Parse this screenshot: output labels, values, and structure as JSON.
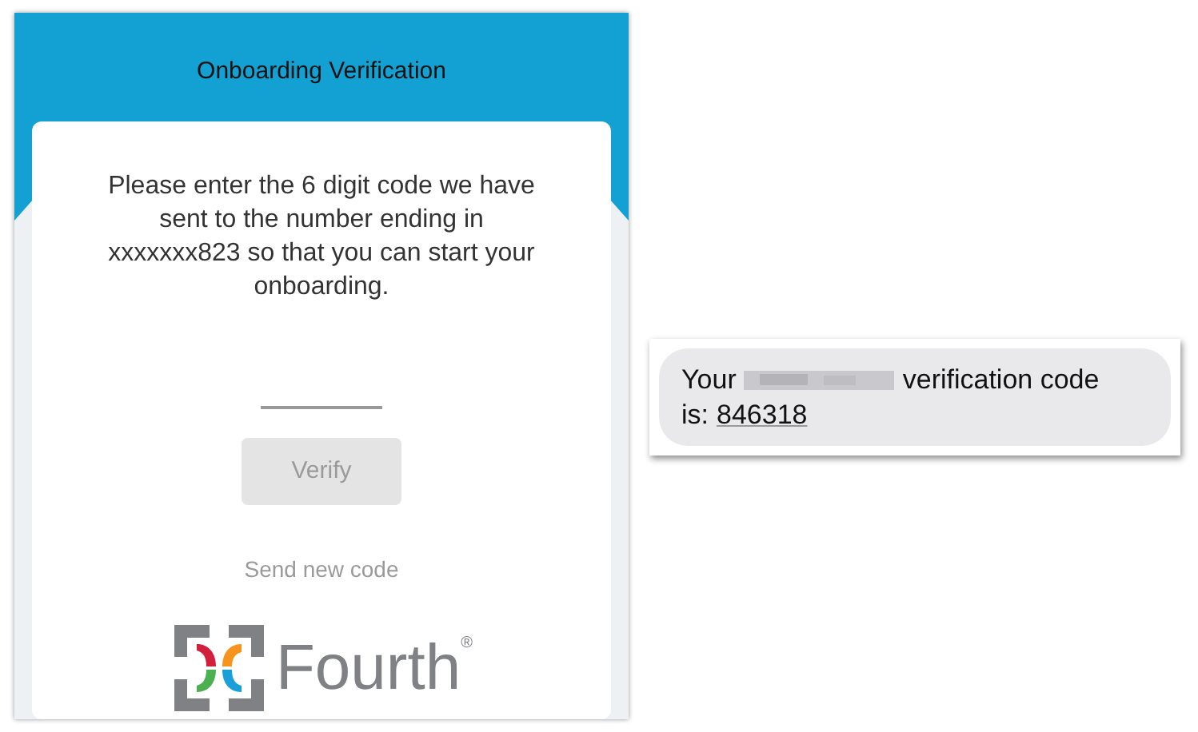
{
  "screen": {
    "title": "Onboarding Verification",
    "instructions": "Please enter the 6 digit code we have sent to the number ending in xxxxxxx823 so that you can start your onboarding.",
    "verify_button": {
      "label": "Verify",
      "disabled": true
    },
    "resend_link": "Send new code",
    "logo": {
      "wordmark": "Fourth",
      "mark": "®"
    }
  },
  "message": {
    "before": "Your",
    "after": "verification code",
    "line_2": "is:",
    "code": "846318"
  }
}
